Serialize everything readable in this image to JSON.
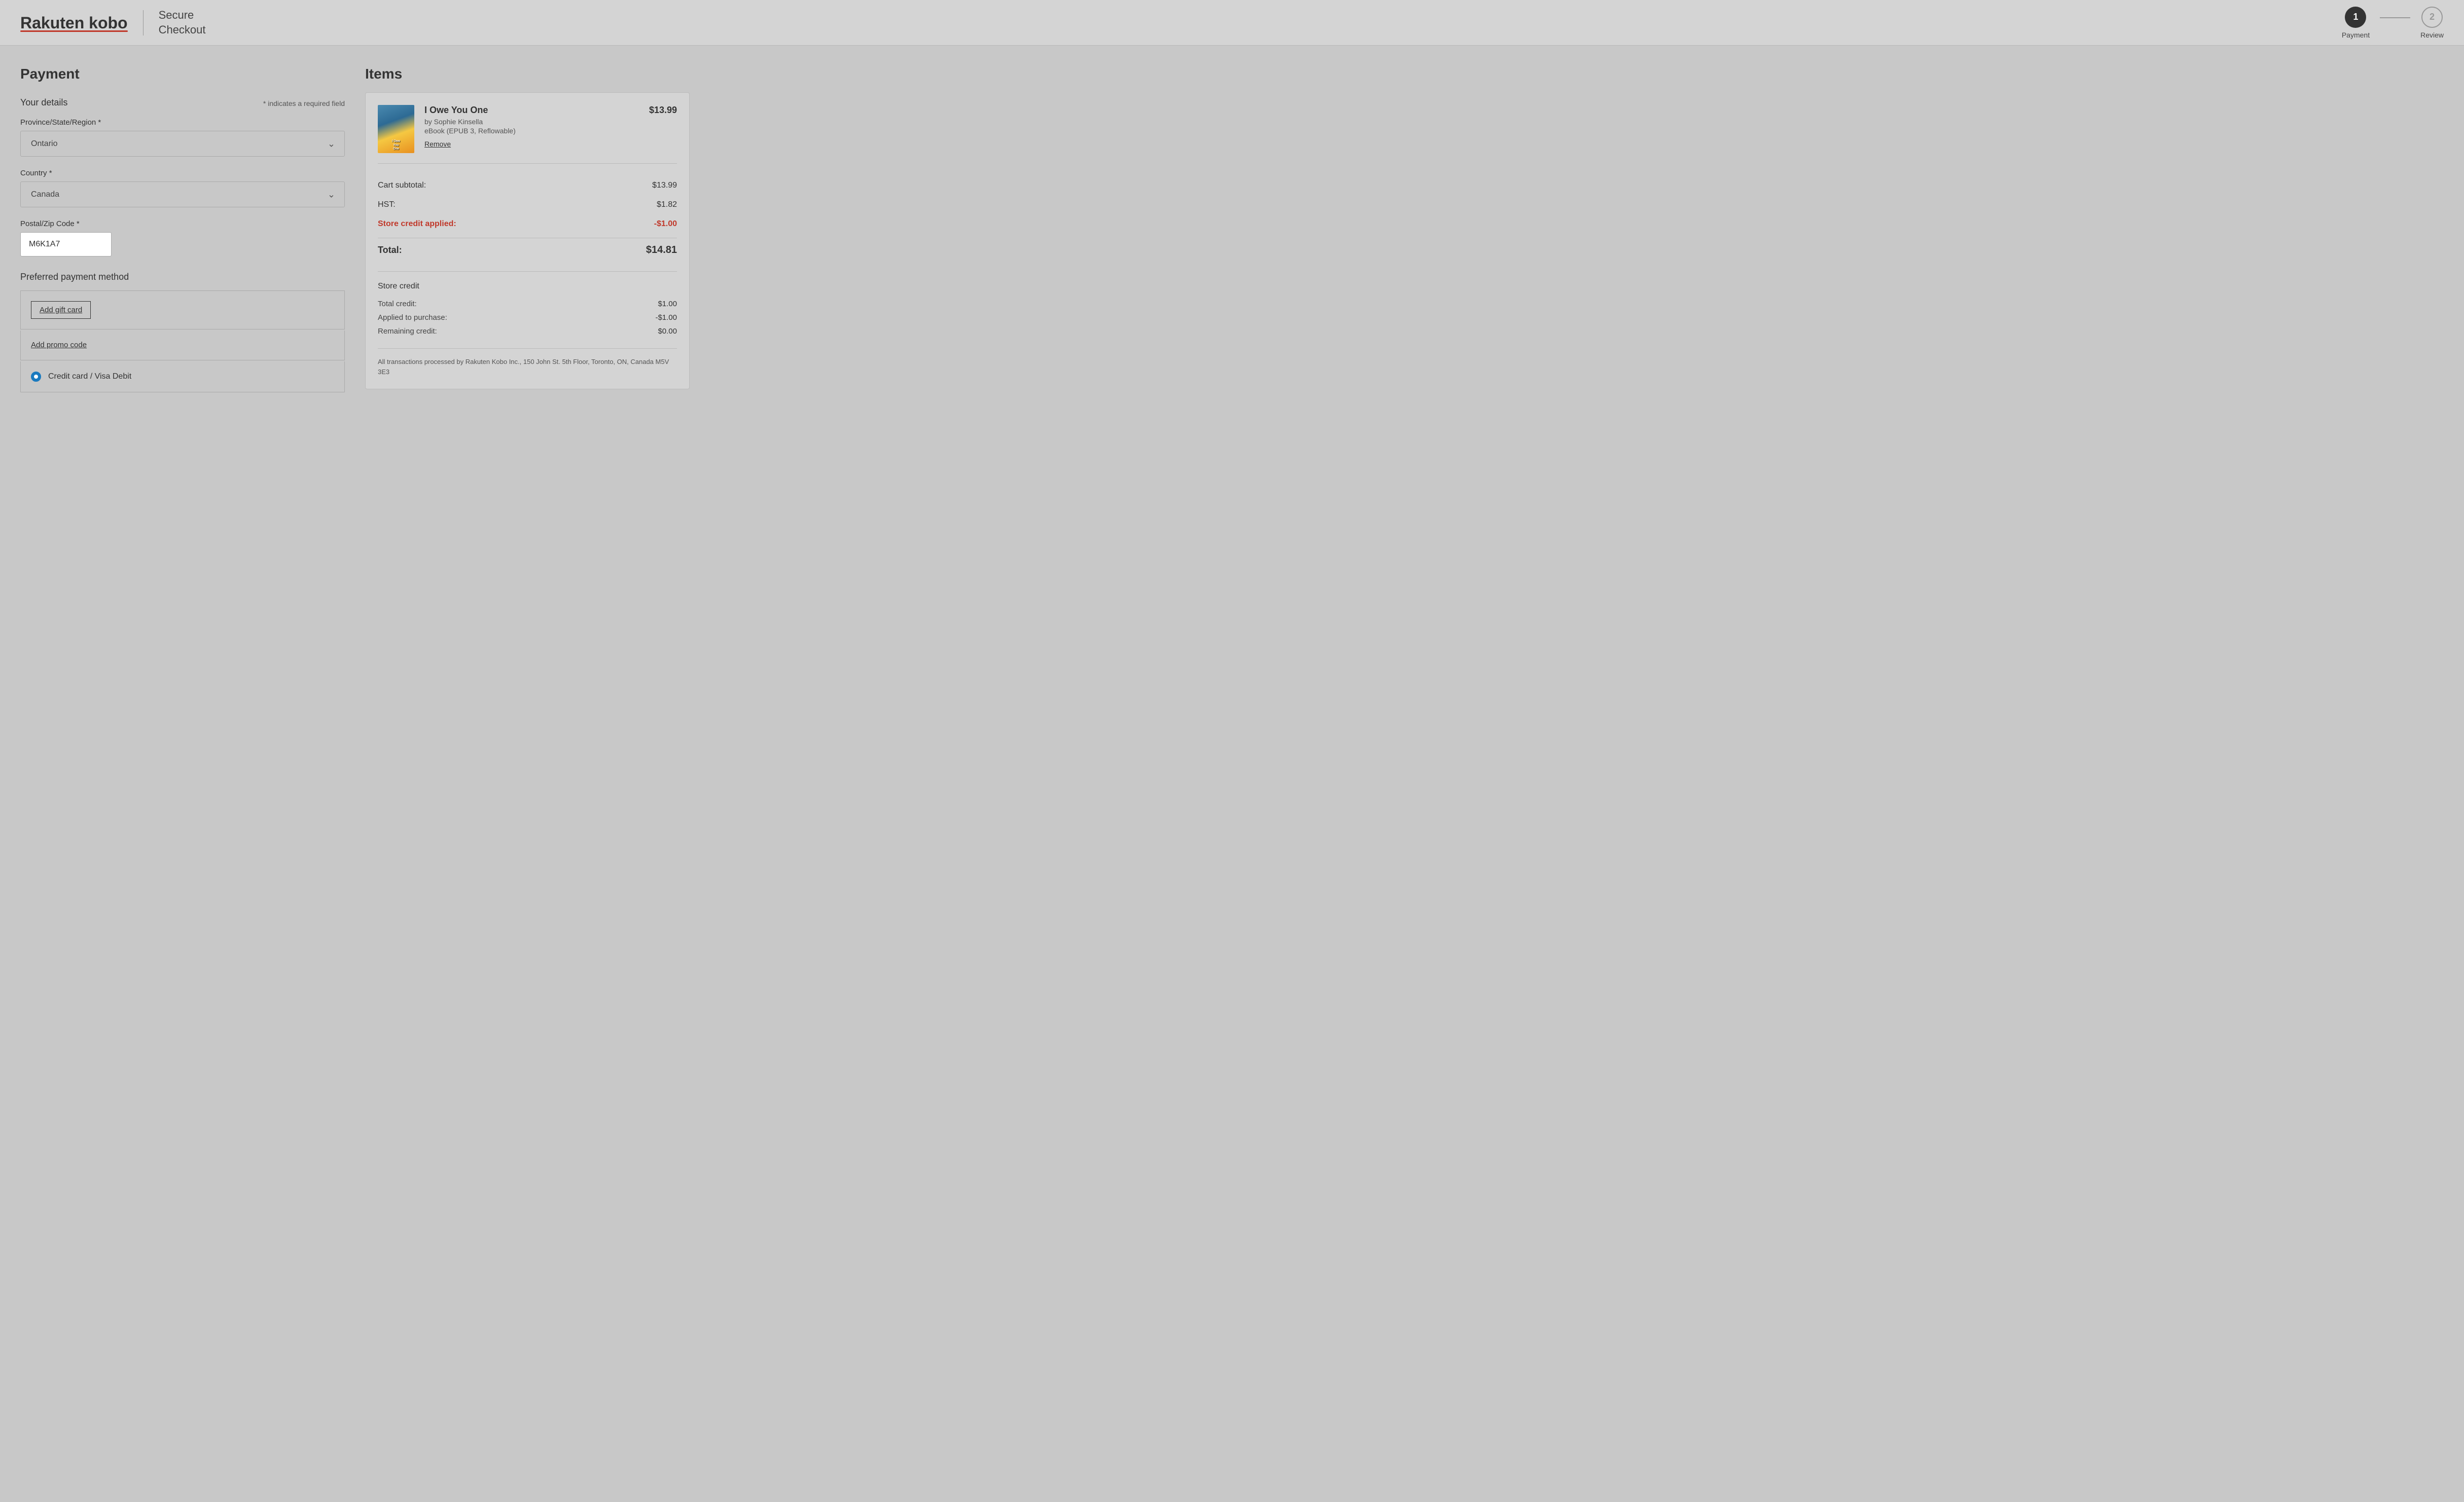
{
  "header": {
    "logo_rakuten": "Rakuten",
    "logo_kobo": "kobo",
    "secure_checkout": "Secure\nCheckout",
    "steps": [
      {
        "number": "1",
        "label": "Payment",
        "active": true
      },
      {
        "number": "2",
        "label": "Review",
        "active": false
      }
    ]
  },
  "payment": {
    "section_title": "Payment",
    "your_details_label": "Your details",
    "required_note": "* indicates a required field",
    "province_label": "Province/State/Region *",
    "province_value": "Ontario",
    "country_label": "Country *",
    "country_value": "Canada",
    "postal_label": "Postal/Zip Code *",
    "postal_value": "M6K1A7",
    "preferred_payment_label": "Preferred payment method",
    "add_gift_card_label": "Add gift card",
    "add_promo_label": "Add promo code",
    "credit_card_label": "Credit card / Visa Debit"
  },
  "items": {
    "section_title": "Items",
    "book": {
      "title": "I Owe You One",
      "author": "by Sophie Kinsella",
      "format": "eBook (EPUB 3, Reflowable)",
      "price": "$13.99",
      "remove_label": "Remove"
    },
    "cart_subtotal_label": "Cart subtotal:",
    "cart_subtotal_value": "$13.99",
    "hst_label": "HST:",
    "hst_value": "$1.82",
    "store_credit_applied_label": "Store credit applied:",
    "store_credit_applied_value": "-$1.00",
    "total_label": "Total:",
    "total_value": "$14.81",
    "store_credit_section_title": "Store credit",
    "total_credit_label": "Total credit:",
    "total_credit_value": "$1.00",
    "applied_to_purchase_label": "Applied to purchase:",
    "applied_to_purchase_value": "-$1.00",
    "remaining_credit_label": "Remaining credit:",
    "remaining_credit_value": "$0.00",
    "transaction_note": "All transactions processed by Rakuten Kobo Inc., 150 John St. 5th Floor, Toronto, ON, Canada M5V 3E3"
  }
}
